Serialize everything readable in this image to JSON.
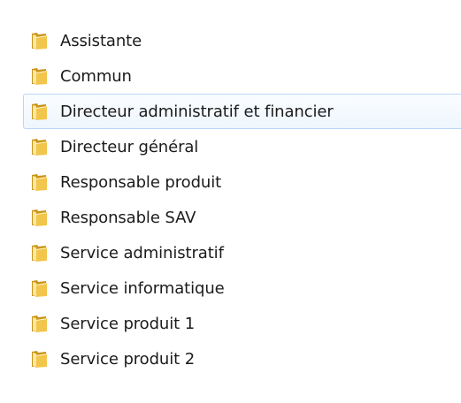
{
  "folders": [
    {
      "label": "Assistante",
      "icon": "folder-icon"
    },
    {
      "label": "Commun",
      "icon": "folder-icon"
    },
    {
      "label": "Directeur administratif et financier",
      "icon": "folder-icon",
      "hovered": true
    },
    {
      "label": "Directeur général",
      "icon": "folder-icon"
    },
    {
      "label": "Responsable produit",
      "icon": "folder-icon"
    },
    {
      "label": "Responsable SAV",
      "icon": "folder-icon"
    },
    {
      "label": "Service administratif",
      "icon": "folder-icon"
    },
    {
      "label": "Service informatique",
      "icon": "folder-icon"
    },
    {
      "label": "Service produit 1",
      "icon": "folder-icon"
    },
    {
      "label": "Service produit 2",
      "icon": "folder-icon"
    }
  ],
  "colors": {
    "folder_body": "#f2c54b",
    "folder_dark": "#c9951a",
    "folder_light": "#fde7a2",
    "hover_border": "#b8d6fb",
    "hover_fill": "#eef6fe"
  }
}
